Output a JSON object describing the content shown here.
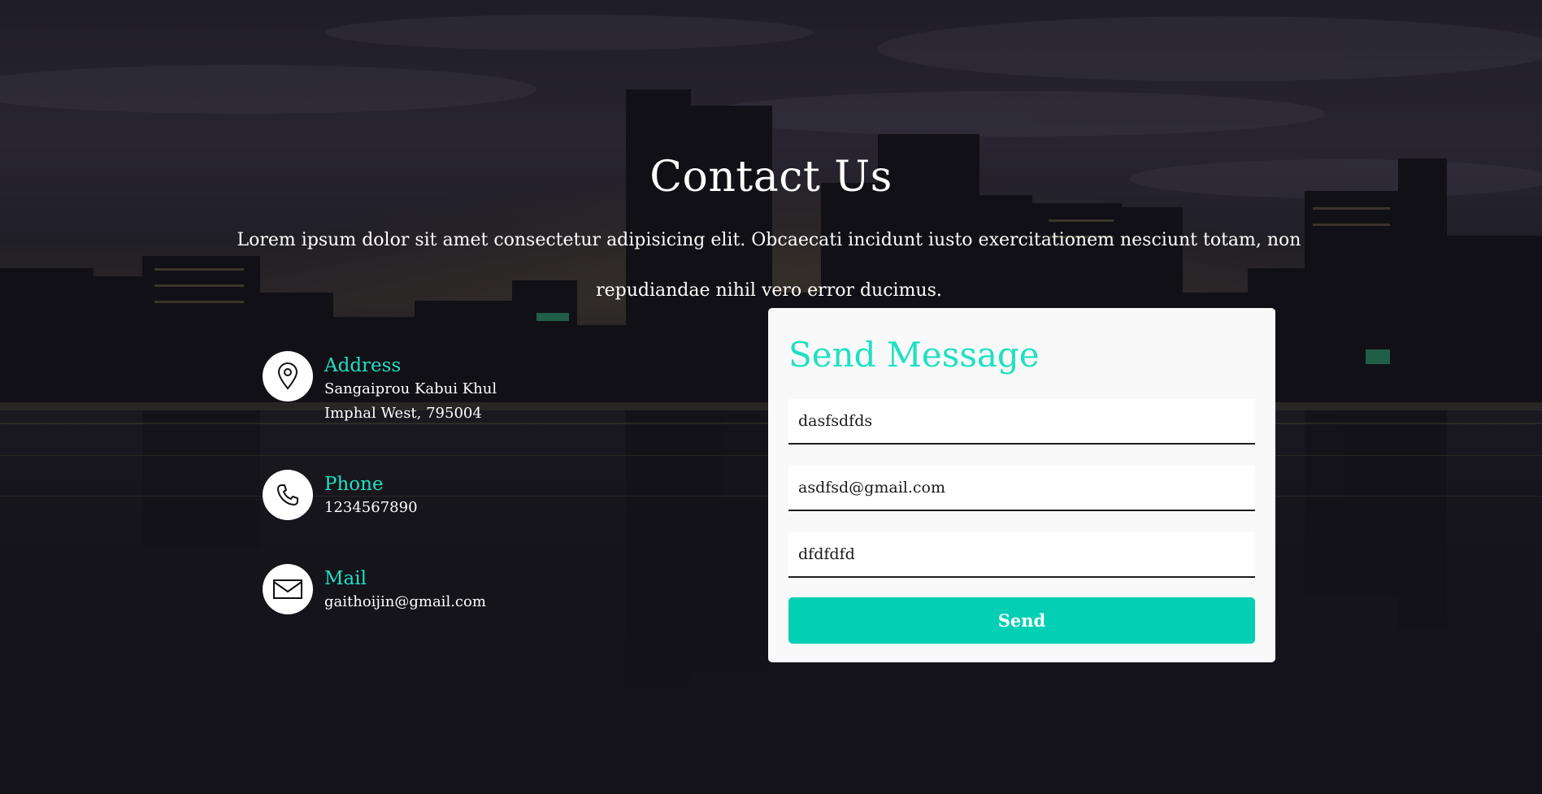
{
  "header": {
    "title": "Contact Us",
    "lead": "Lorem ipsum dolor sit amet consectetur adipisicing elit. Obcaecati incidunt iusto exercitationem nesciunt totam, non repudiandae nihil vero error ducimus."
  },
  "info": {
    "address": {
      "label": "Address",
      "line1": "Sangaiprou Kabui Khul",
      "line2": "Imphal West, 795004",
      "icon": "map-pin-icon"
    },
    "phone": {
      "label": "Phone",
      "value": "1234567890",
      "icon": "phone-icon"
    },
    "mail": {
      "label": "Mail",
      "value": "gaithoijin@gmail.com",
      "icon": "envelope-icon"
    }
  },
  "form": {
    "title": "Send Message",
    "name_value": "dasfsdfds",
    "email_value": "asdfsd@gmail.com",
    "message_value": "dfdfdfd",
    "send_label": "Send"
  },
  "colors": {
    "accent": "#1fe0c2",
    "button": "#02cfb3",
    "card": "#f9f9f9"
  }
}
